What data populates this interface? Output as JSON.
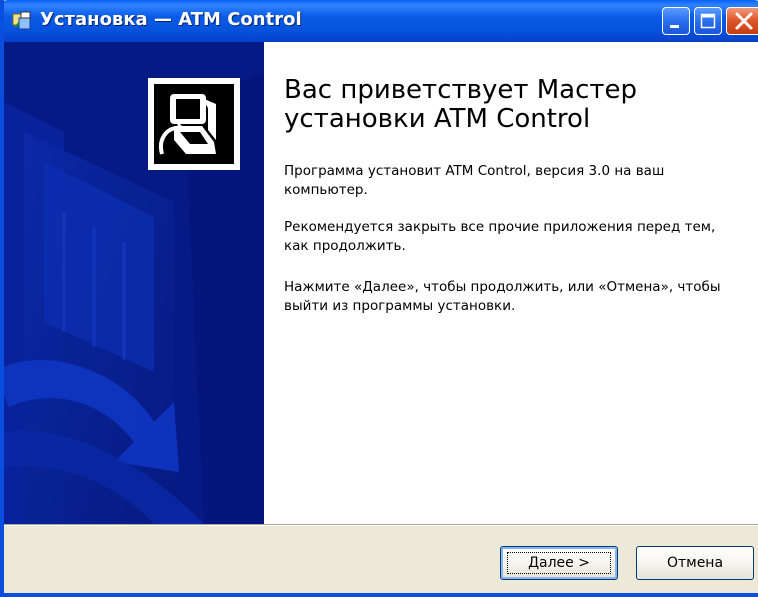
{
  "window": {
    "title": "Установка — ATM Control",
    "icon": "installer-icon",
    "controls": [
      "minimize-icon",
      "maximize-icon",
      "close-icon"
    ]
  },
  "sidebar": {
    "image": "setup-wizard-banner",
    "logo_icon": "computer-install-icon"
  },
  "main": {
    "heading": "Вас приветствует Мастер установки ATM Control",
    "paragraphs": [
      "Программа установит ATM Control, версия 3.0 на ваш компьютер.",
      "Рекомендуется закрыть все прочие приложения перед тем, как продолжить.",
      "Нажмите «Далее», чтобы продолжить, или «Отмена», чтобы выйти из программы установки."
    ]
  },
  "buttons": {
    "next_label_accel": "Д",
    "next_label_rest": "алее >",
    "cancel_label": "Отмена"
  },
  "colors": {
    "titlebar": "#0a5ae6",
    "sidebar": "#071c8a",
    "dialog_bg": "#ece9d8",
    "close_button": "#e2572c"
  }
}
